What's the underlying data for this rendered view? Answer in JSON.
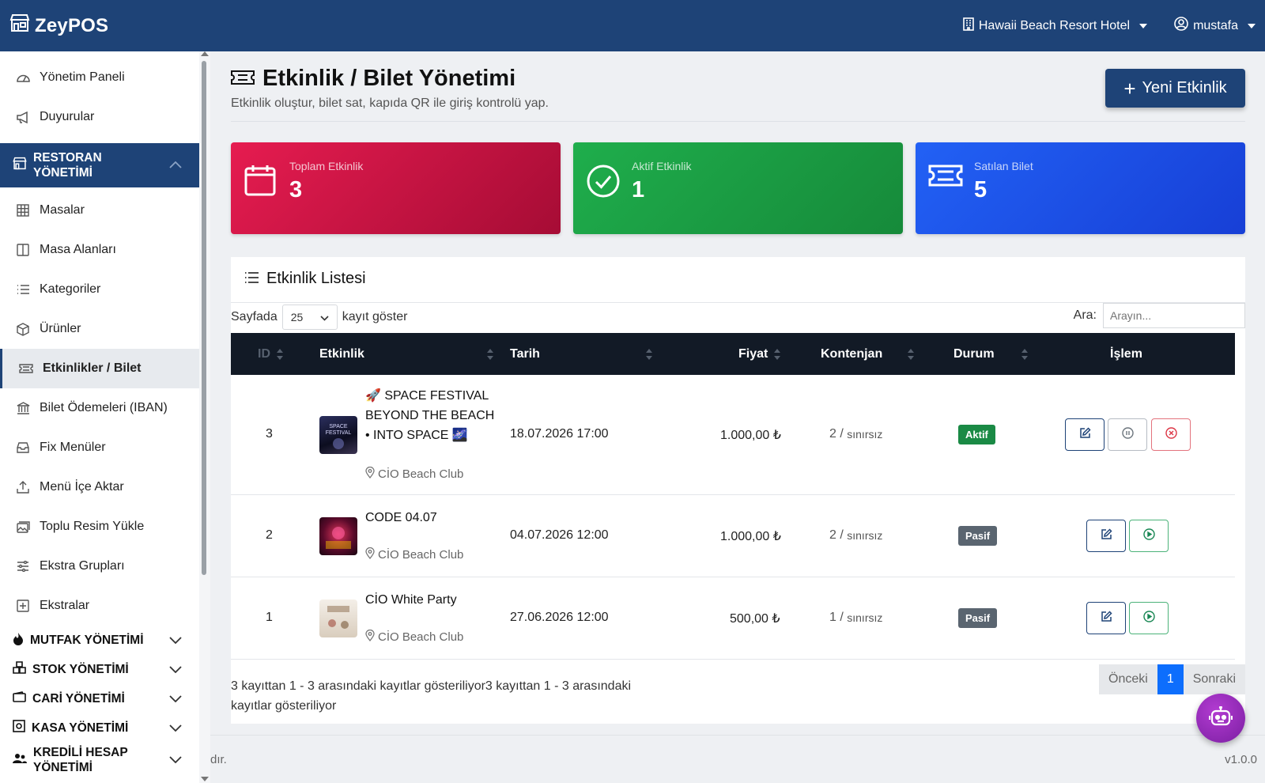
{
  "brand": {
    "name": "ZeyPOS"
  },
  "topbar": {
    "hotel": "Hawaii Beach Resort Hotel",
    "user": "mustafa"
  },
  "sidebar": {
    "items_top": [
      {
        "label": "Yönetim Paneli",
        "icon": "dashboard-icon"
      },
      {
        "label": "Duyurular",
        "icon": "megaphone-icon"
      }
    ],
    "active_section": "RESTORAN YÖNETİMİ",
    "items": [
      {
        "label": "Masalar",
        "icon": "grid-icon"
      },
      {
        "label": "Masa Alanları",
        "icon": "layout-icon"
      },
      {
        "label": "Kategoriler",
        "icon": "list-icon"
      },
      {
        "label": "Ürünler",
        "icon": "box-icon"
      },
      {
        "label": "Etkinlikler / Bilet",
        "icon": "ticket-icon"
      },
      {
        "label": "Bilet Ödemeleri (IBAN)",
        "icon": "bank-icon"
      },
      {
        "label": "Fix Menüler",
        "icon": "inbox-icon"
      },
      {
        "label": "Menü İçe Aktar",
        "icon": "upload-icon"
      },
      {
        "label": "Toplu Resim Yükle",
        "icon": "images-icon"
      },
      {
        "label": "Ekstra Grupları",
        "icon": "sliders-icon"
      },
      {
        "label": "Ekstralar",
        "icon": "plus-square-icon"
      }
    ],
    "sections": [
      "MUTFAK YÖNETİMİ",
      "STOK YÖNETİMİ",
      "CARİ YÖNETİMİ",
      "KASA YÖNETİMİ",
      "KREDİLİ HESAP",
      "YÖNETİMİ"
    ]
  },
  "page": {
    "title": "Etkinlik / Bilet Yönetimi",
    "subtitle": "Etkinlik oluştur, bilet sat, kapıda QR ile giriş kontrolü yap.",
    "new_button": "Yeni Etkinlik"
  },
  "stats": [
    {
      "label": "Toplam Etkinlik",
      "value": "3"
    },
    {
      "label": "Aktif Etkinlik",
      "value": "1"
    },
    {
      "label": "Satılan Bilet",
      "value": "5"
    }
  ],
  "list": {
    "title": "Etkinlik Listesi",
    "length_prefix": "Sayfada",
    "length_value": "25",
    "length_suffix": "kayıt göster",
    "search_label": "Ara:",
    "search_placeholder": "Arayın...",
    "columns": {
      "id": "ID",
      "event": "Etkinlik",
      "date": "Tarih",
      "price": "Fiyat",
      "quota": "Kontenjan",
      "status": "Durum",
      "action": "İşlem"
    },
    "rows": [
      {
        "id": "3",
        "name_l1": "🚀 SPACE FESTIVAL",
        "name_l2": "BEYOND THE BEACH",
        "name_l3": "• INTO SPACE 🌌",
        "location": "CİO Beach Club",
        "date": "18.07.2026 17:00",
        "price": "1.000,00 ₺",
        "quota_n": "2 /",
        "quota_s": "sınırsız",
        "status": "Aktif"
      },
      {
        "id": "2",
        "name_l1": "CODE 04.07",
        "location": "CİO Beach Club",
        "date": "04.07.2026 12:00",
        "price": "1.000,00 ₺",
        "quota_n": "2 /",
        "quota_s": "sınırsız",
        "status": "Pasif"
      },
      {
        "id": "1",
        "name_l1": "CİO White Party",
        "location": "CİO Beach Club",
        "date": "27.06.2026 12:00",
        "price": "500,00 ₺",
        "quota_n": "1 /",
        "quota_s": "sınırsız",
        "status": "Pasif"
      }
    ],
    "info_l1": "3 kayıttan 1 - 3 arasındaki kayıtlar gösteriliyor3 kayıttan 1 - 3 arasındaki",
    "info_l2": "kayıtlar gösteriliyor",
    "pager": {
      "prev": "Önceki",
      "current": "1",
      "next": "Sonraki"
    }
  },
  "footer": {
    "left": "dır.",
    "version": "v1.0.0"
  }
}
